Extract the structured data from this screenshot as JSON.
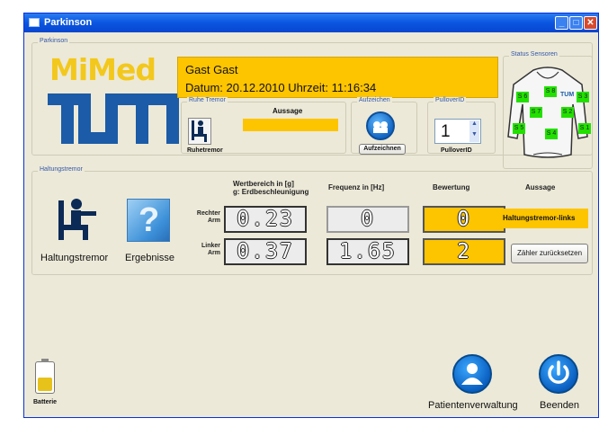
{
  "window": {
    "title": "Parkinson"
  },
  "groups": {
    "main": "Parkinson",
    "status_sensoren": "Status Sensoren",
    "ruhe_tremor": "Ruhe Tremor",
    "aufzeichen": "Aufzeichen",
    "pullover_id": "PulloverID",
    "haltungstremor": "Haltungstremor"
  },
  "logo": {
    "mimed": "MiMed",
    "tum": "TUM"
  },
  "patient": {
    "name": "Gast Gast",
    "datetime": "Datum: 20.12.2010 Uhrzeit: 11:16:34"
  },
  "ruhe": {
    "button_label": "Ruhetremor",
    "aussage_label": "Aussage",
    "aussage_value": ""
  },
  "aufzeichen": {
    "button_label": "Aufzeichnen"
  },
  "pullover": {
    "value": "1",
    "label": "PulloverID"
  },
  "sensors": [
    "S 8",
    "TUM",
    "S 6",
    "S 3",
    "S 7",
    "S 2",
    "S 5",
    "S 1",
    "S 4"
  ],
  "haltung": {
    "button_label": "Haltungstremor",
    "ergebnisse_label": "Ergebnisse",
    "col_wertbereich": "Wertbereich in [g]",
    "col_wertbereich_sub": "g: Erdbeschleunigung",
    "col_frequenz": "Frequenz in [Hz]",
    "col_bewertung": "Bewertung",
    "col_aussage": "Aussage",
    "rechter_arm": "Rechter Arm",
    "linker_arm": "Linker Arm",
    "rechter_wert": "0.23",
    "linker_wert": "0.37",
    "rechter_freq": "0",
    "linker_freq": "1.65",
    "rechter_bewertung": "0",
    "linker_bewertung": "2",
    "aussage_value": "Haltungstremor-links",
    "reset_button": "Zähler zurücksetzen"
  },
  "bottom": {
    "batterie": "Batterie",
    "patientenverwaltung": "Patientenverwaltung",
    "beenden": "Beenden"
  },
  "colors": {
    "accent_yellow": "#fdc400",
    "titlebar_blue": "#0a55e0",
    "sensor_green": "#22e000",
    "tum_blue": "#1b5ba8"
  }
}
